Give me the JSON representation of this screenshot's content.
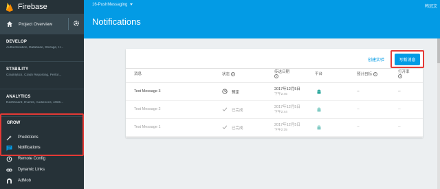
{
  "app": {
    "name": "Firebase",
    "project": "16-PushMessaging",
    "user": "韩冠文"
  },
  "sidebar": {
    "overview": "Project Overview",
    "sections": [
      {
        "title": "DEVELOP",
        "sub": "Authentication, Database, Storage, H..."
      },
      {
        "title": "STABILITY",
        "sub": "Crashlytics, Crash Reporting, Perfor..."
      },
      {
        "title": "ANALYTICS",
        "sub": "Dashboard, Events, Audiences, Attrib..."
      }
    ],
    "grow": {
      "title": "GROW",
      "items": [
        {
          "label": "Predictions"
        },
        {
          "label": "Notifications"
        }
      ]
    },
    "more": [
      {
        "label": "Remote Config"
      },
      {
        "label": "Dynamic Links"
      },
      {
        "label": "AdMob"
      }
    ]
  },
  "page": {
    "title": "Notifications"
  },
  "card": {
    "experiment_button": "创建实验",
    "new_message_button": "写新消息",
    "columns": {
      "message": "消息",
      "status": "状态",
      "sent_date": "传送日期",
      "platform": "平台",
      "estimate": "预计目标",
      "open_rate": "打开率"
    },
    "rows": [
      {
        "message": "Test Message 3",
        "status": "预定",
        "date": "2017年12月5日",
        "time": "下午2:45",
        "estimate": "--",
        "open_rate": "--"
      },
      {
        "message": "Test Message 2",
        "status": "已完成",
        "date": "2017年12月5日",
        "time": "下午2:44",
        "estimate": "--",
        "open_rate": "--"
      },
      {
        "message": "Test Message 1",
        "status": "已完成",
        "date": "2017年12月5日",
        "time": "下午2:35",
        "estimate": "--",
        "open_rate": "--"
      }
    ]
  },
  "colors": {
    "sidebar": "#263238",
    "header": "#039be5",
    "highlight": "#e53935",
    "android": "#26a69a"
  },
  "icons": [
    "firebase-logo-icon",
    "home-icon",
    "gear-icon",
    "predictions-icon",
    "notifications-icon",
    "remote-config-icon",
    "dynamic-links-icon",
    "admob-icon",
    "help-icon",
    "clock-icon",
    "check-icon",
    "android-icon"
  ]
}
